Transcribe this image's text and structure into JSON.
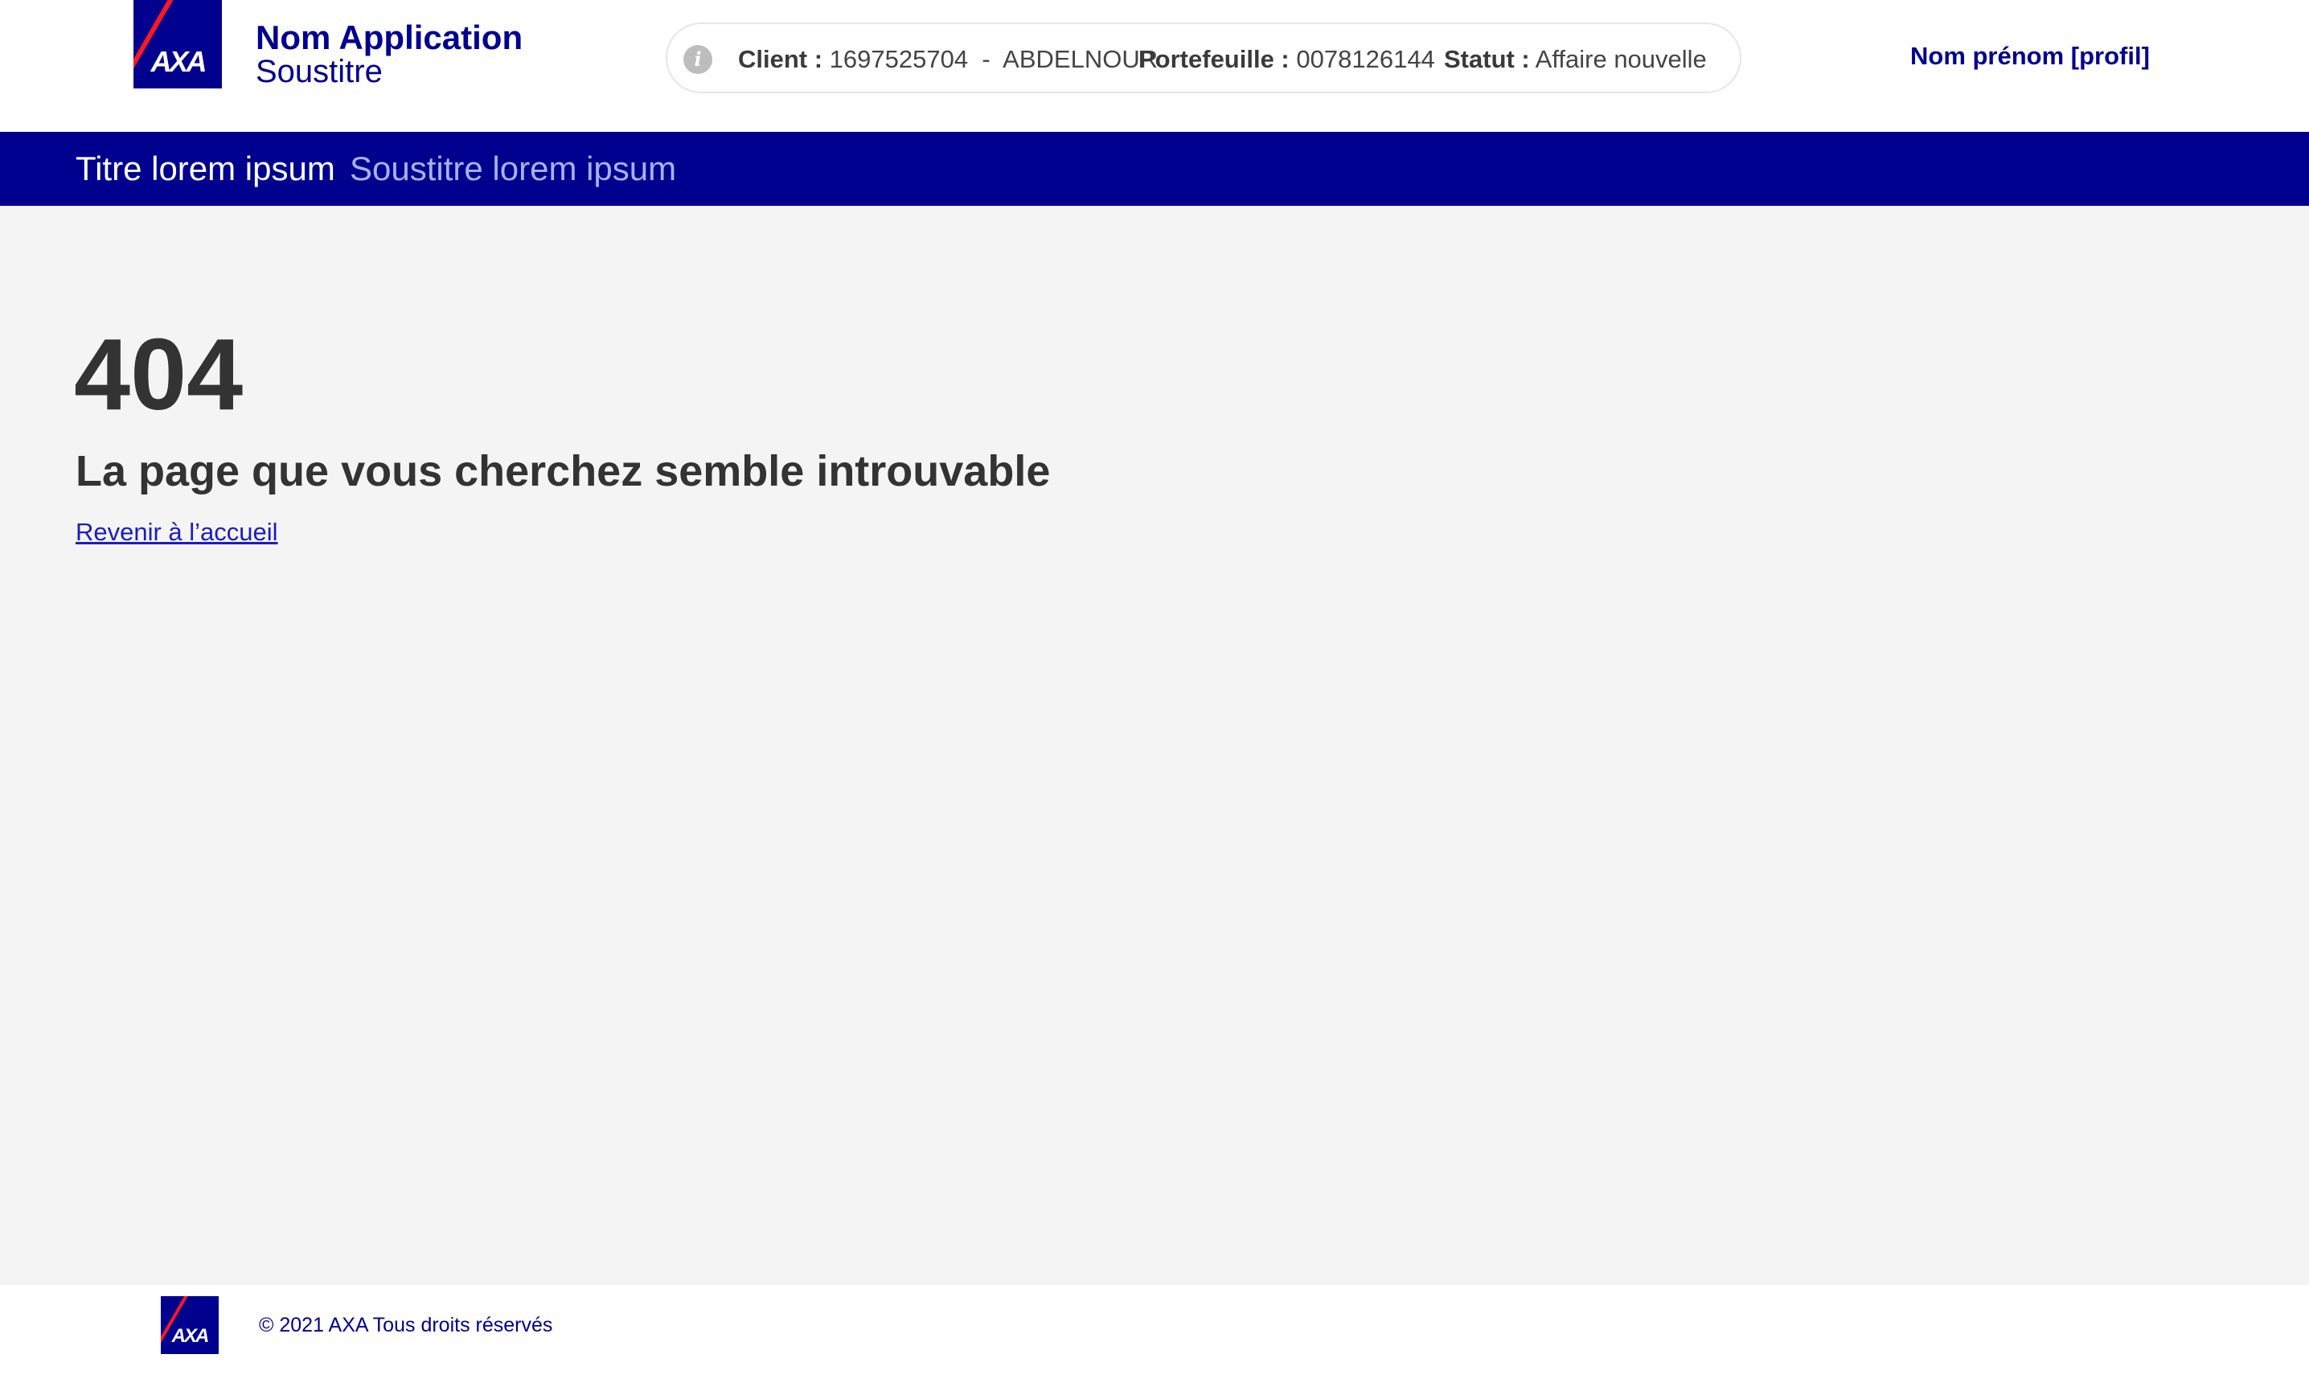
{
  "brand": {
    "logo_text": "AXA",
    "color_primary": "#00008f",
    "color_accent": "#ff1721"
  },
  "header": {
    "app_name": "Nom Application",
    "app_subtitle": "Soustitre",
    "context": {
      "icon": "info-icon",
      "client_label": "Client :",
      "client_value": "1697525704  -  ABDELNOUR",
      "portfolio_label": "Portefeuille :",
      "portfolio_value": "0078126144",
      "status_label": "Statut :",
      "status_value": "Affaire nouvelle"
    },
    "profile_link": "Nom prénom [profil]"
  },
  "title_band": {
    "title": "Titre lorem ipsum",
    "subtitle": "Soustitre lorem ipsum"
  },
  "main": {
    "error_code": "404",
    "error_message": "La page que vous cherchez semble introuvable",
    "home_link": "Revenir à l’accueil"
  },
  "footer": {
    "copyright": "© 2021 AXA Tous droits réservés"
  }
}
